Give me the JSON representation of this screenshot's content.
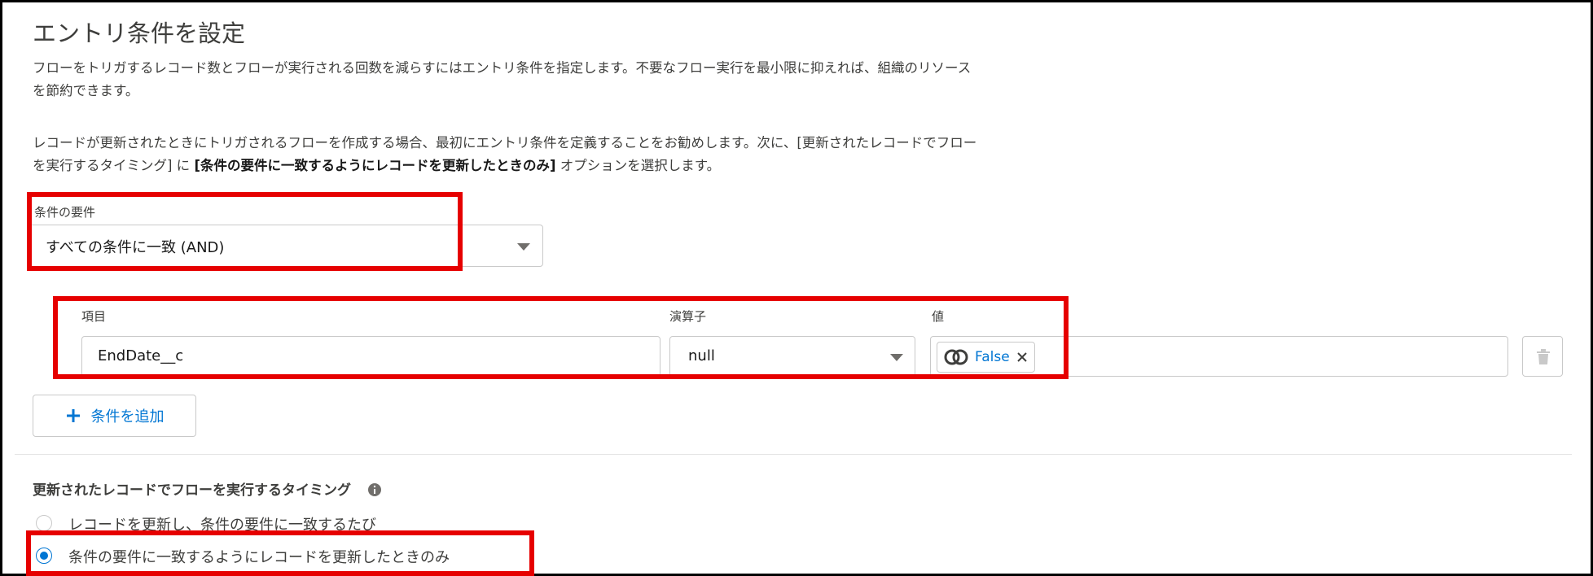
{
  "title": "エントリ条件を設定",
  "description": {
    "para1_line1": "フローをトリガするレコード数とフローが実行される回数を減らすにはエントリ条件を指定します。不要なフロー実行を最小限に抑えれば、組織のリソース",
    "para1_line2": "を節約できます。",
    "para2_line1": "レコードが更新されたときにトリガされるフローを作成する場合、最初にエントリ条件を定義することをお勧めします。次に、[更新されたレコードでフロー",
    "para2_line2_a": "を実行するタイミング] に ",
    "para2_line2_b": "[条件の要件に一致するようにレコードを更新したときのみ]",
    "para2_line2_c": " オプションを選択します。"
  },
  "requirement": {
    "label": "条件の要件",
    "selected": "すべての条件に一致 (AND)"
  },
  "condition": {
    "field_label": "項目",
    "field_value": "EndDate__c",
    "operator_label": "演算子",
    "operator_value": "null",
    "value_label": "値",
    "value_pill": "False"
  },
  "add_condition_label": "条件を追加",
  "timing": {
    "heading": "更新されたレコードでフローを実行するタイミング",
    "options": [
      {
        "label": "レコードを更新し、条件の要件に一致するたび",
        "checked": false
      },
      {
        "label": "条件の要件に一致するようにレコードを更新したときのみ",
        "checked": true
      }
    ]
  },
  "colors": {
    "accent": "#0176d3",
    "highlight": "#e60000"
  },
  "icons": [
    "chevron-down-icon",
    "global-variable-icon",
    "close-icon",
    "trash-icon",
    "add-icon",
    "info-icon"
  ]
}
